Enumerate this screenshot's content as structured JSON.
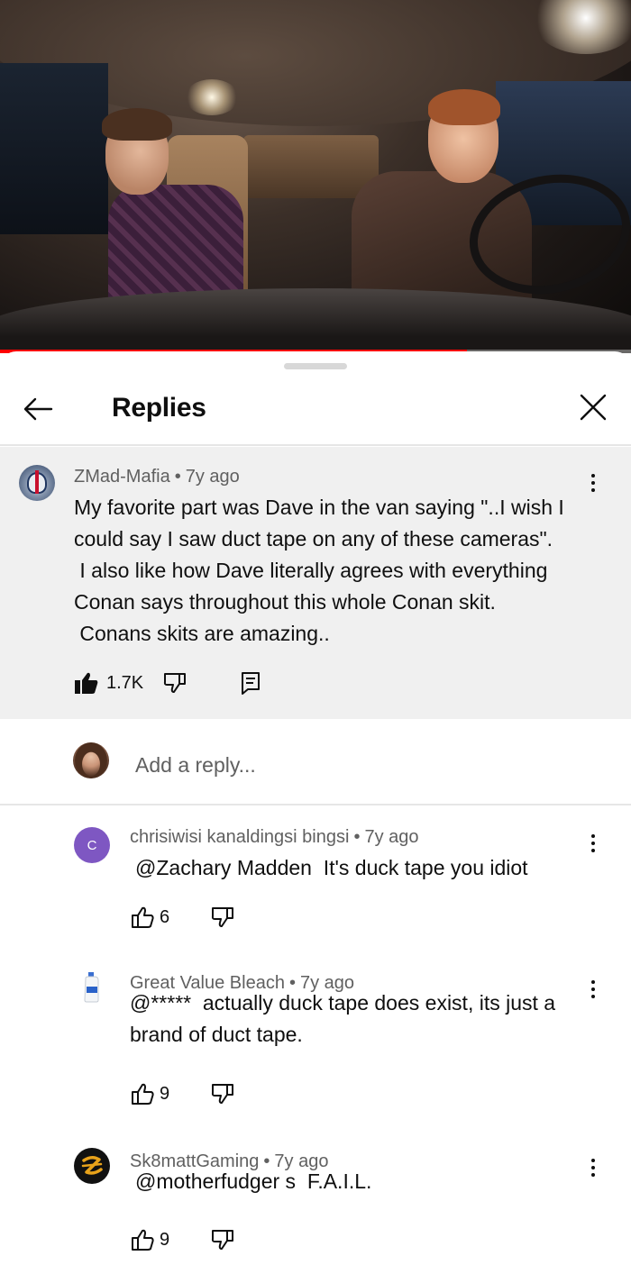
{
  "video": {
    "progress_fraction": 0.74,
    "progress_color": "#ff0000"
  },
  "sheet": {
    "title": "Replies",
    "back_icon": "arrow-left-icon",
    "close_icon": "close-icon"
  },
  "main_comment": {
    "author": "ZMad-Mafia",
    "age": "7y ago",
    "separator": "•",
    "text": "My favorite part was Dave in the van saying \"..I wish I\ncould say I saw duct tape on any of these cameras\".\n I also like how Dave literally agrees with everything\nConan says throughout this whole Conan skit.\n Conans skits are amazing..",
    "likes": "1.7K",
    "liked": true
  },
  "add_reply": {
    "placeholder": "Add a reply..."
  },
  "replies": [
    {
      "author": "chrisiwisi kanaldingsi bingsi",
      "age": "7y ago",
      "avatar_letter": "C",
      "avatar_color": "#7e57c2",
      "text": "@Zachary Madden  It's duck tape you idiot",
      "likes": "6"
    },
    {
      "author": "Great Value Bleach",
      "age": "7y ago",
      "text": "@*****  actually duck tape does exist, its just a\nbrand of duct tape.",
      "likes": "9"
    },
    {
      "author": "Sk8mattGaming",
      "age": "7y ago",
      "text": "@motherfudger s  F.A.I.L.",
      "likes": "9"
    }
  ]
}
